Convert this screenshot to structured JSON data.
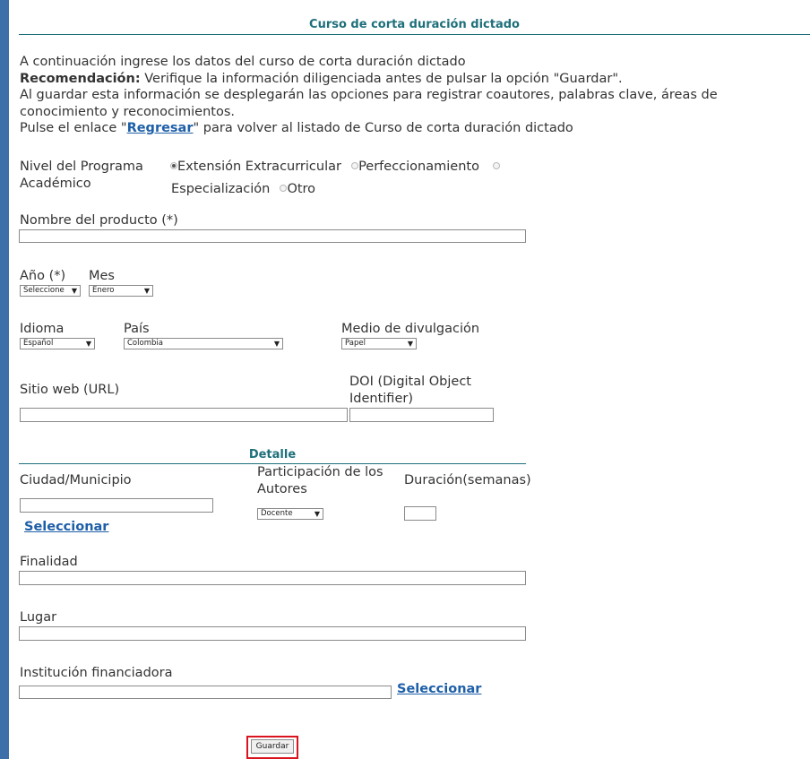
{
  "header": {
    "title": "Curso de corta duración dictado"
  },
  "intro": {
    "line1": "A continuación ingrese los datos del curso de corta duración dictado",
    "recommendation_label": "Recomendación:",
    "recommendation_text": " Verifique la información diligenciada antes de pulsar la opción \"Guardar\".",
    "line3": "Al guardar esta información se desplegarán las opciones para registrar coautores, palabras clave, áreas de conocimiento y reconocimientos.",
    "line4_before": "Pulse el enlace \"",
    "line4_link": "Regresar",
    "line4_after": "\" para volver al listado de Curso de corta duración dictado"
  },
  "nivel": {
    "label": "Nivel del Programa Académico",
    "options": [
      "Extensión Extracurricular",
      "Perfeccionamiento",
      "Especialización",
      "Otro"
    ],
    "selected": "Extensión Extracurricular"
  },
  "nombre": {
    "label": "Nombre del producto (*)",
    "value": ""
  },
  "anio": {
    "label": "Año (*)",
    "value": "Seleccione"
  },
  "mes": {
    "label": "Mes",
    "value": "Enero"
  },
  "idioma": {
    "label": "Idioma",
    "value": "Español"
  },
  "pais": {
    "label": "País",
    "value": "Colombia"
  },
  "medio": {
    "label": "Medio de divulgación",
    "value": "Papel"
  },
  "sitio": {
    "label": "Sitio web (URL)",
    "value": ""
  },
  "doi": {
    "label": "DOI (Digital Object Identifier)",
    "value": ""
  },
  "detalle": {
    "title": "Detalle"
  },
  "ciudad": {
    "label": "Ciudad/Municipio",
    "value": "",
    "link": "Seleccionar"
  },
  "participacion": {
    "label": "Participación de los Autores",
    "value": "Docente"
  },
  "duracion": {
    "label": "Duración(semanas)",
    "value": ""
  },
  "finalidad": {
    "label": "Finalidad",
    "value": ""
  },
  "lugar": {
    "label": "Lugar",
    "value": ""
  },
  "institucion": {
    "label": "Institución financiadora",
    "value": "",
    "link": "Seleccionar"
  },
  "actions": {
    "save_label": "Guardar"
  }
}
